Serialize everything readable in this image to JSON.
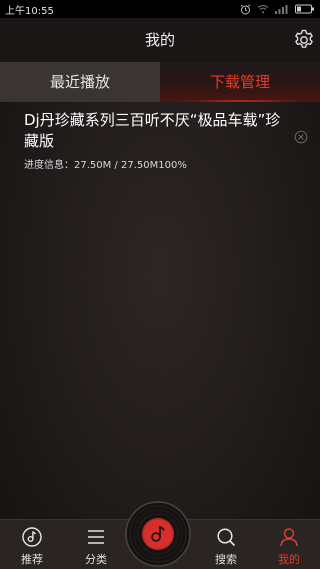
{
  "status_bar": {
    "time": "上午10:55"
  },
  "header": {
    "title": "我的"
  },
  "tabs": [
    {
      "label": "最近播放",
      "active": false
    },
    {
      "label": "下载管理",
      "active": true
    }
  ],
  "downloads": [
    {
      "title": "Dj丹珍藏系列三百听不厌“极品车载”珍藏版",
      "progress": "进度信息：27.50M / 27.50M100%"
    }
  ],
  "bottom_nav": [
    {
      "label": "推荐",
      "icon": "music-note-circle-icon",
      "active": false
    },
    {
      "label": "分类",
      "icon": "menu-lines-icon",
      "active": false
    },
    {
      "label": "搜索",
      "icon": "search-icon",
      "active": false
    },
    {
      "label": "我的",
      "icon": "user-icon",
      "active": true
    }
  ],
  "colors": {
    "accent": "#e53b2c",
    "background": "#1f1a19",
    "nav_background": "#2a2423"
  }
}
